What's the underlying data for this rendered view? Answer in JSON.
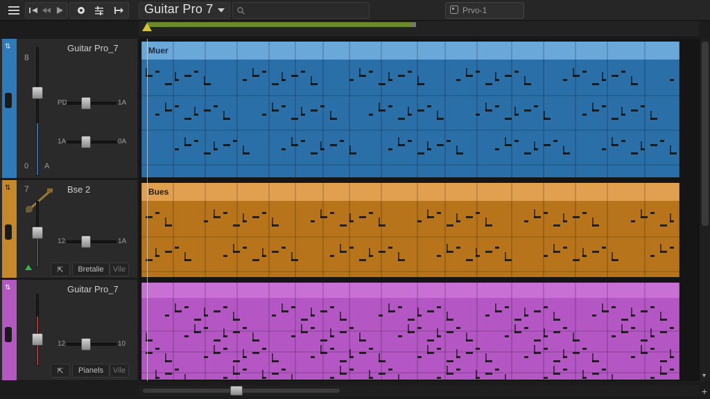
{
  "toolbar": {
    "app_title": "Guitar Pro 7",
    "project_label": "Prvo-1",
    "icons": [
      "menu-icon",
      "previous-icon",
      "rewind-icon",
      "play-icon",
      "metronome-icon",
      "mixer-icon",
      "count-in-icon",
      "chevron-down-icon",
      "search-icon",
      "score-icon"
    ]
  },
  "tracks": [
    {
      "name": "Guitar Pro_7",
      "header_tag": "Muer",
      "color": "#2f7ab8",
      "lane_color": "#2a6fa8",
      "fader_top": "8",
      "fader_bottom_left": "0",
      "fader_bottom_right": "A",
      "sliders": [
        {
          "left": "PD",
          "right": "1A"
        },
        {
          "left": "1A",
          "right": "0A"
        }
      ]
    },
    {
      "name": "Bse 2",
      "header_tag": "Bues",
      "color": "#c7872b",
      "lane_color": "#b8741a",
      "fader_top": "7",
      "sliders": [
        {
          "left": "12",
          "right": "1A"
        }
      ],
      "button_label": "Bretalie",
      "button_right": "Vile"
    },
    {
      "name": "Guitar Pro_7",
      "header_tag": "",
      "color": "#b258c0",
      "lane_color": "#b457c4",
      "fader_top": "",
      "sliders": [
        {
          "left": "12",
          "right": "10"
        }
      ],
      "button_label": "Pianels",
      "button_right": "Vile"
    }
  ]
}
